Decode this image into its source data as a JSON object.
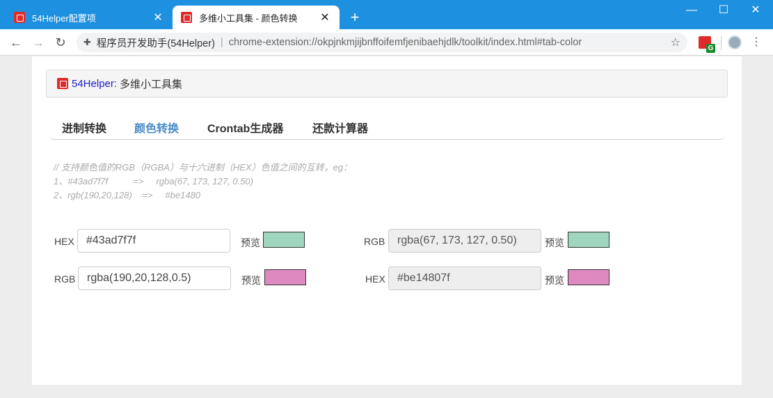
{
  "browser": {
    "tabs": [
      {
        "title": "54Helper配置项",
        "close": "✕"
      },
      {
        "title": "多维小工具集 - 颜色转换",
        "close": "✕"
      }
    ],
    "new_tab": "+",
    "window_controls": {
      "minimize": "—",
      "maximize": "☐",
      "close": "✕"
    },
    "site_name": "程序员开发助手(54Helper)",
    "separator": "|",
    "url": "chrome-extension://okpjnkmjijbnffoifemfjenibaehjdlk/toolkit/index.html#tab-color",
    "ext_badge": "G"
  },
  "header": {
    "brand": "54Helper",
    "colon": ":",
    "title": "多维小工具集"
  },
  "tabs": [
    "进制转换",
    "颜色转换",
    "Crontab生成器",
    "还款计算器"
  ],
  "active_tab": 1,
  "description": {
    "line1": "// 支持颜色值的RGB（RGBA）与十六进制（HEX）色值之间的互转，eg：",
    "line2": "1、#43ad7f7f          =>     rgba(67, 173, 127, 0.50)",
    "line3": "2、rgb(190,20,128)    =>     #be1480"
  },
  "converter": {
    "row1": {
      "input_label": "HEX",
      "input_value": "#43ad7f7f",
      "preview_label": "预览",
      "preview_color": "#a0d6be",
      "output_label": "RGB",
      "output_value": "rgba(67, 173, 127, 0.50)",
      "output_preview_label": "预览",
      "output_preview_color": "#a0d6be"
    },
    "row2": {
      "input_label": "RGB",
      "input_value": "rgba(190,20,128,0.5)",
      "preview_label": "预览",
      "preview_color": "#de8abf",
      "output_label": "HEX",
      "output_value": "#be14807f",
      "output_preview_label": "预览",
      "output_preview_color": "#de8abf"
    }
  }
}
